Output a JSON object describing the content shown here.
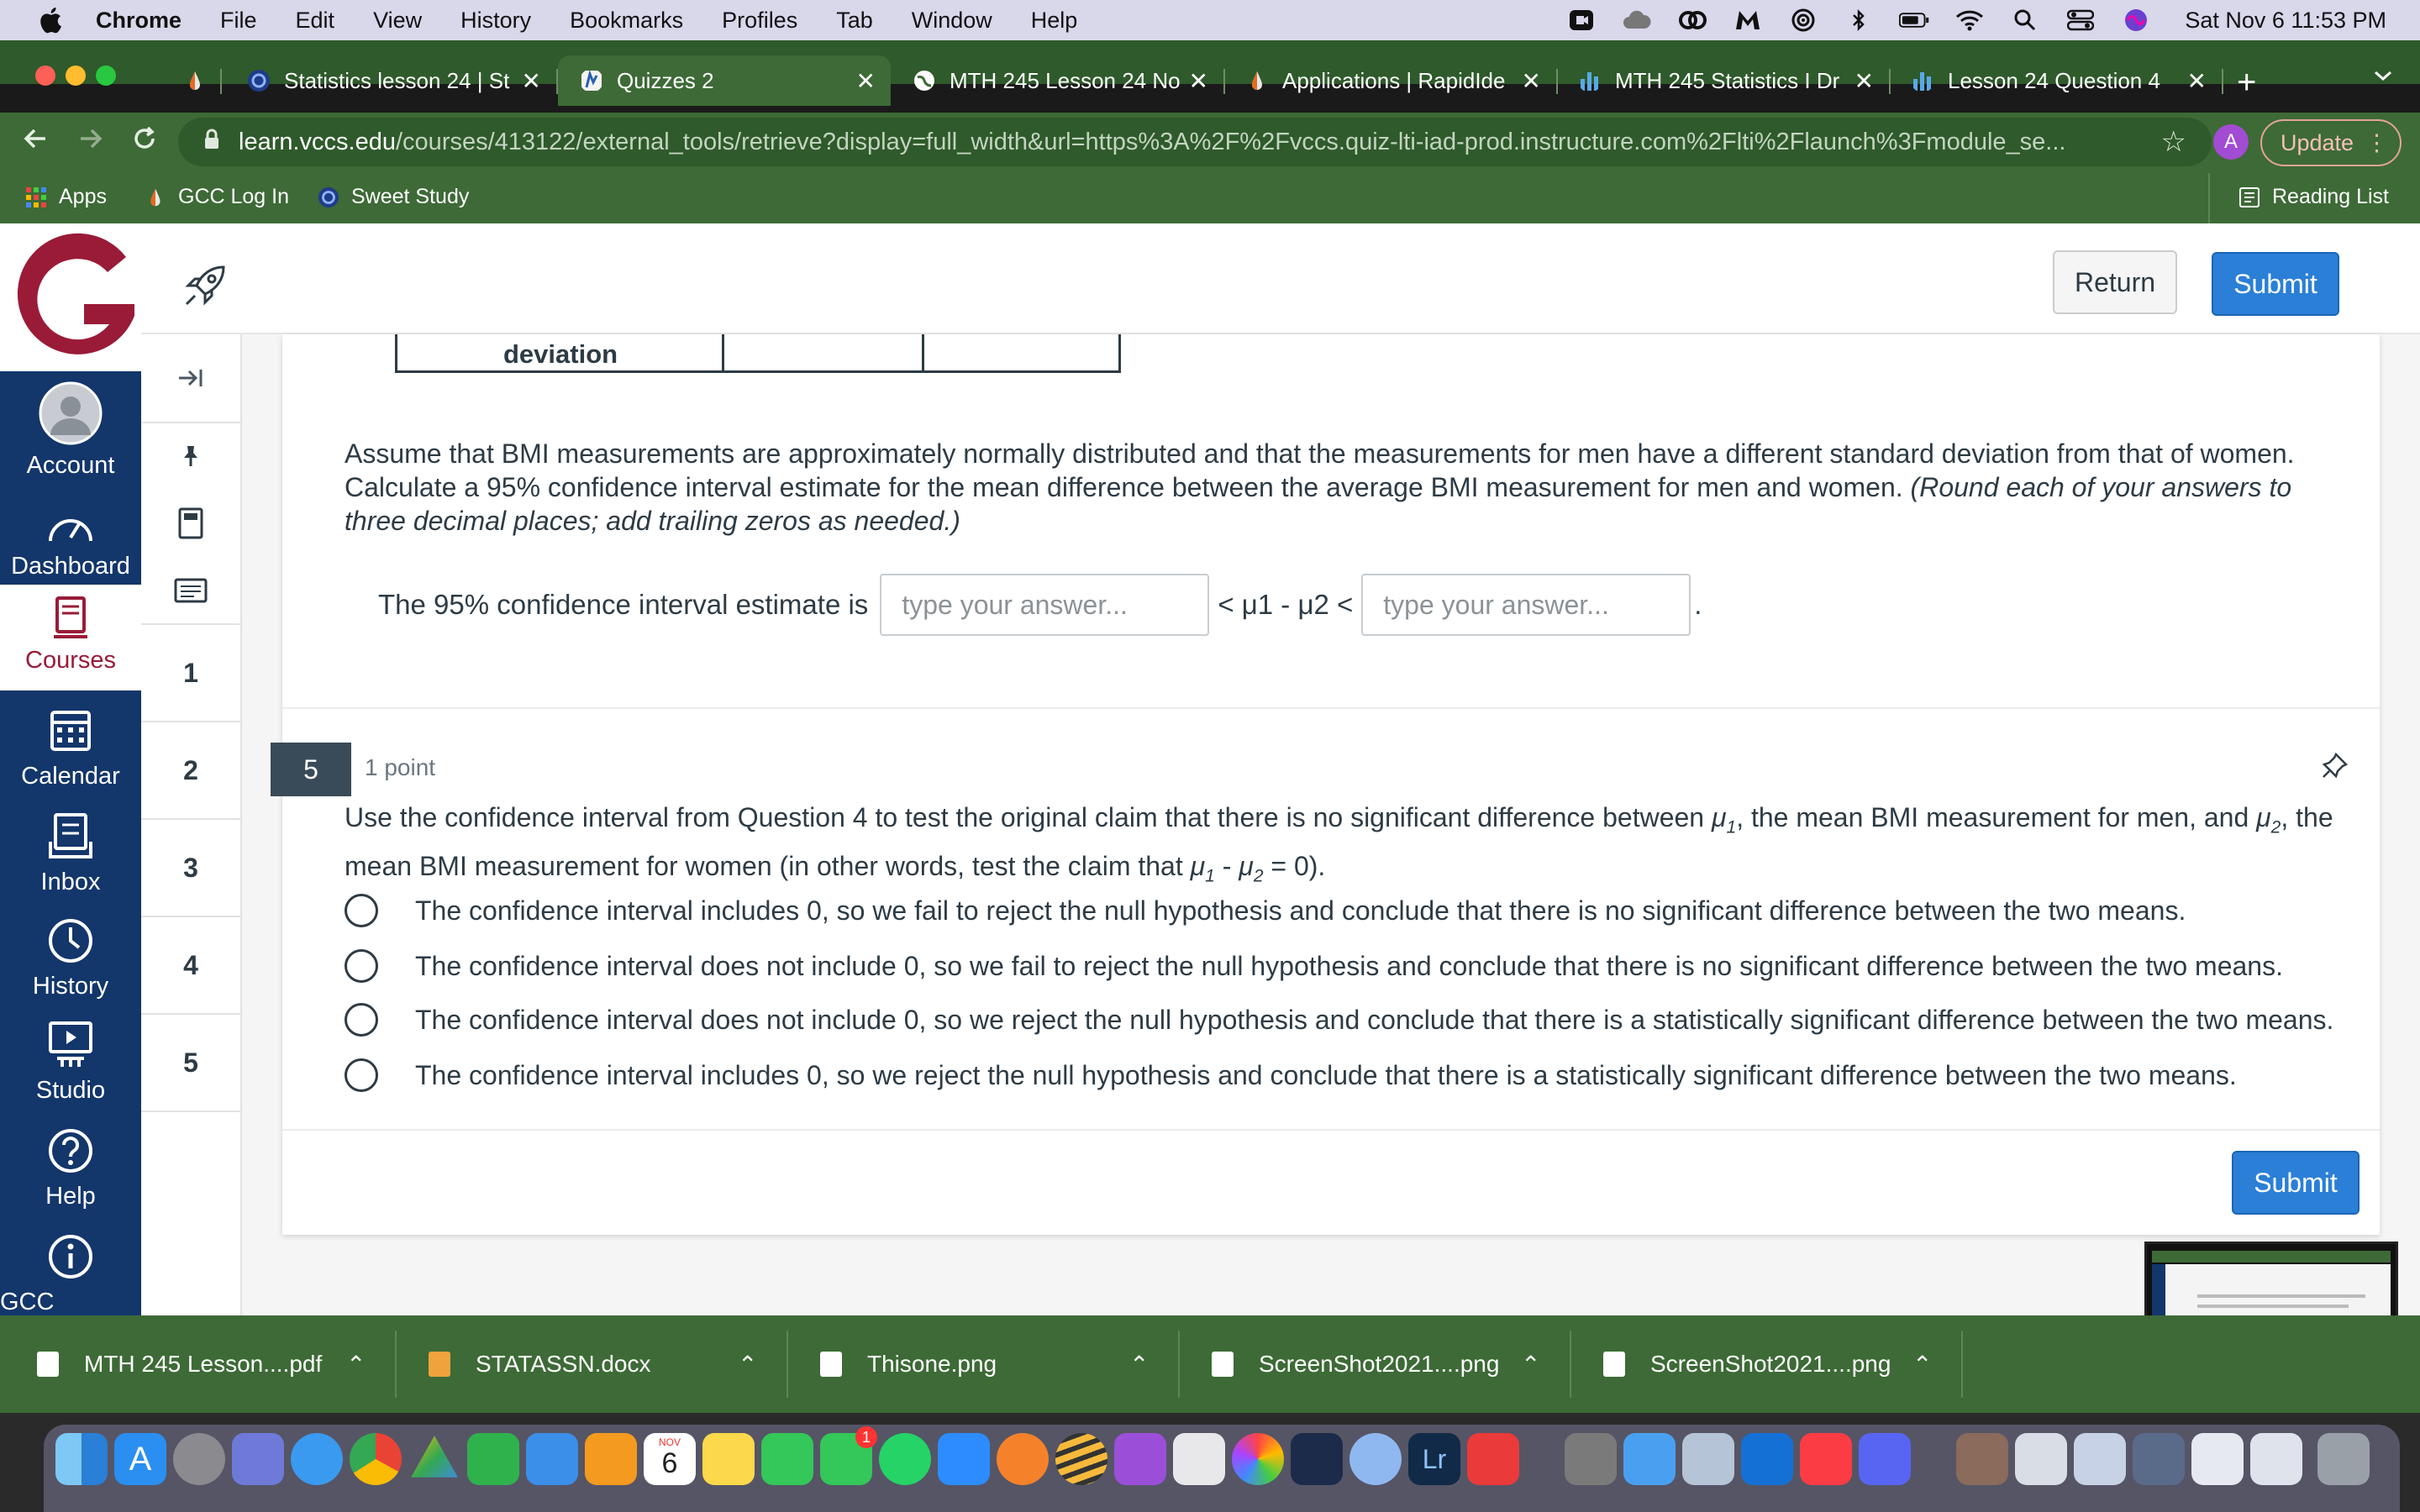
{
  "menubar": {
    "app": "Chrome",
    "items": [
      "File",
      "Edit",
      "View",
      "History",
      "Bookmarks",
      "Profiles",
      "Tab",
      "Window",
      "Help"
    ],
    "clock": "Sat Nov 6  11:53 PM"
  },
  "tabs": [
    {
      "title": "Statistics lesson 24 | St"
    },
    {
      "title": "Quizzes 2"
    },
    {
      "title": "MTH 245 Lesson 24 No"
    },
    {
      "title": "Applications | RapidIde"
    },
    {
      "title": "MTH 245 Statistics I Dr"
    },
    {
      "title": "Lesson 24 Question 4"
    }
  ],
  "toolbar": {
    "url_domain": "learn.vccs.edu",
    "url_path": "/courses/413122/external_tools/retrieve?display=full_width&url=https%3A%2F%2Fvccs.quiz-lti-iad-prod.instructure.com%2Flti%2Flaunch%3Fmodule_se...",
    "profile_letter": "A",
    "update_label": "Update"
  },
  "bookmarks": {
    "items": [
      "Apps",
      "GCC Log In",
      "Sweet Study"
    ],
    "reading_list": "Reading List"
  },
  "nav": {
    "items": [
      "Account",
      "Dashboard",
      "Courses",
      "Calendar",
      "Inbox",
      "History",
      "Studio",
      "Help",
      "GCC Student"
    ]
  },
  "header": {
    "return_label": "Return",
    "submit_label": "Submit"
  },
  "quiz_side": {
    "numbers": [
      "1",
      "2",
      "3",
      "4",
      "5"
    ]
  },
  "question4": {
    "table_fragment": "deviation",
    "text_plain": "Assume that BMI measurements are approximately normally distributed and that the measurements for men have a different standard deviation from that of women. Calculate a 95% confidence interval estimate for the mean difference between the average BMI measurement for men and women.",
    "text_italic": "(Round each of your answers to three decimal places; add trailing zeros as needed.)",
    "ci_label": "The 95% confidence interval estimate is",
    "placeholder": "type your answer...",
    "between": "< μ1 - μ2 <",
    "end": "."
  },
  "question5": {
    "number": "5",
    "points": "1 point",
    "text_a": "Use the confidence interval from Question 4 to test the original claim that there is no significant difference between ",
    "mu1": "μ",
    "sub1": "1",
    "text_b": ", the mean BMI measurement for men, and ",
    "mu2": "μ",
    "sub2": "2",
    "text_c": ", the mean BMI measurement for women (in other words, test the claim that ",
    "text_d": " - ",
    "text_e": " = 0).",
    "options": [
      "The confidence interval includes 0, so we fail to reject the null hypothesis and conclude that there is no significant difference between the two means.",
      "The confidence interval does not include 0, so we fail to reject the null hypothesis and conclude that there is no significant difference between the two means.",
      "The confidence interval does not include 0, so we reject the null hypothesis and conclude that there is a statistically significant difference between the two means.",
      "The confidence interval includes 0, so we reject the null hypothesis and conclude that there is a statistically significant difference between the two means."
    ]
  },
  "footer": {
    "submit_label": "Submit"
  },
  "downloads": [
    {
      "name": "MTH 245 Lesson....pdf"
    },
    {
      "name": "STATASSN.docx"
    },
    {
      "name": "Thisone.png"
    },
    {
      "name": "ScreenShot2021....png"
    },
    {
      "name": "ScreenShot2021....png"
    }
  ],
  "dock": {
    "calendar_month": "NOV",
    "calendar_day": "6",
    "messages_badge": "1",
    "lr_label": "Lr"
  },
  "colors": {
    "chrome_theme": "#3d6a36",
    "canvas_nav": "#13366b",
    "brand_red": "#9a1b37",
    "button_blue": "#2b7fd6"
  }
}
